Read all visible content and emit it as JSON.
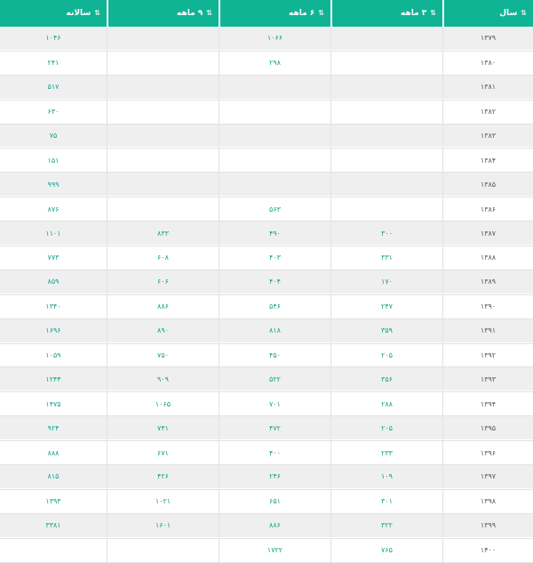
{
  "table": {
    "headers": {
      "year": "سال",
      "m3": "۳ ماهه",
      "m6": "۶ ماهه",
      "m9": "۹ ماهه",
      "annual": "سالانه"
    },
    "sort_icon": "⇅",
    "rows": [
      {
        "year": "۱۳۷۹",
        "m3": "",
        "m6": "۱۰۶۶",
        "m9": "",
        "annual": "۱۰۴۶"
      },
      {
        "year": "۱۳۸۰",
        "m3": "",
        "m6": "۲۹۸",
        "m9": "",
        "annual": "۲۴۱"
      },
      {
        "year": "۱۳۸۱",
        "m3": "",
        "m6": "",
        "m9": "",
        "annual": "۵۱۷"
      },
      {
        "year": "۱۳۸۲",
        "m3": "",
        "m6": "",
        "m9": "",
        "annual": "۶۳۰"
      },
      {
        "year": "۱۳۸۳",
        "m3": "",
        "m6": "",
        "m9": "",
        "annual": "۷۵"
      },
      {
        "year": "۱۳۸۴",
        "m3": "",
        "m6": "",
        "m9": "",
        "annual": "۱۵۱"
      },
      {
        "year": "۱۳۸۵",
        "m3": "",
        "m6": "",
        "m9": "",
        "annual": "۹۹۹"
      },
      {
        "year": "۱۳۸۶",
        "m3": "",
        "m6": "۵۶۳",
        "m9": "",
        "annual": "۸۷۶"
      },
      {
        "year": "۱۳۸۷",
        "m3": "۳۰۰",
        "m6": "۴۹۰",
        "m9": "۸۳۳",
        "annual": "۱۱۰۱"
      },
      {
        "year": "۱۳۸۸",
        "m3": "۳۳۱",
        "m6": "۴۰۳",
        "m9": "۶۰۸",
        "annual": "۷۷۳"
      },
      {
        "year": "۱۳۸۹",
        "m3": "۱۷۰",
        "m6": "۴۰۴",
        "m9": "۶۰۶",
        "annual": "۸۵۹"
      },
      {
        "year": "۱۳۹۰",
        "m3": "۲۴۷",
        "m6": "۵۴۶",
        "m9": "۸۸۶",
        "annual": "۱۳۴۰"
      },
      {
        "year": "۱۳۹۱",
        "m3": "۳۵۹",
        "m6": "۸۱۸",
        "m9": "۸۹۰",
        "annual": "۱۶۹۶"
      },
      {
        "year": "۱۳۹۲",
        "m3": "۲۰۵",
        "m6": "۴۵۰",
        "m9": "۷۵۰",
        "annual": "۱۰۵۹"
      },
      {
        "year": "۱۳۹۳",
        "m3": "۳۵۶",
        "m6": "۵۲۲",
        "m9": "۹۰۹",
        "annual": "۱۲۴۴"
      },
      {
        "year": "۱۳۹۴",
        "m3": "۲۸۸",
        "m6": "۷۰۱",
        "m9": "۱۰۶۵",
        "annual": "۱۴۷۵"
      },
      {
        "year": "۱۳۹۵",
        "m3": "۲۰۵",
        "m6": "۴۷۲",
        "m9": "۷۴۱",
        "annual": "۹۲۴"
      },
      {
        "year": "۱۳۹۶",
        "m3": "۲۳۳",
        "m6": "۴۰۰",
        "m9": "۶۷۱",
        "annual": "۸۸۸"
      },
      {
        "year": "۱۳۹۷",
        "m3": "۱۰۹",
        "m6": "۲۴۶",
        "m9": "۴۲۶",
        "annual": "۸۱۵"
      },
      {
        "year": "۱۳۹۸",
        "m3": "۳۰۱",
        "m6": "۶۵۱",
        "m9": "۱۰۲۱",
        "annual": "۱۳۹۳"
      },
      {
        "year": "۱۳۹۹",
        "m3": "۳۲۲",
        "m6": "۸۸۶",
        "m9": "۱۶۰۱",
        "annual": "۳۳۸۱"
      },
      {
        "year": "۱۴۰۰",
        "m3": "۷۶۵",
        "m6": "۱۷۲۲",
        "m9": "",
        "annual": ""
      }
    ]
  }
}
